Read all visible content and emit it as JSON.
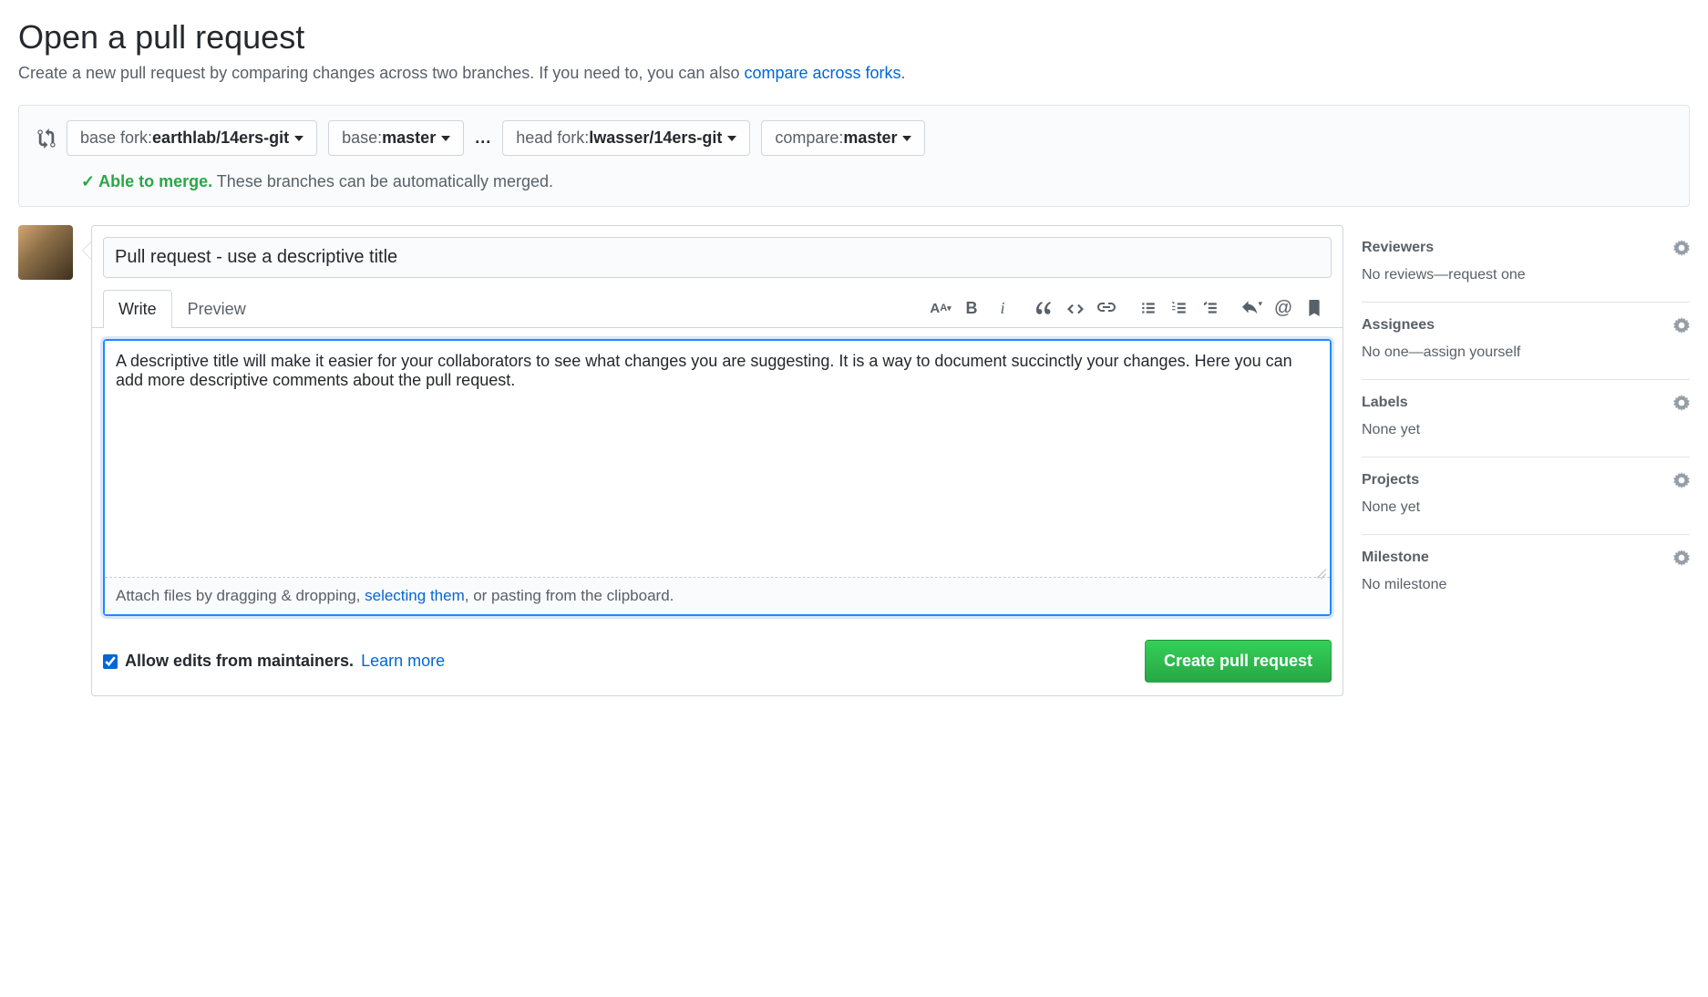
{
  "header": {
    "title": "Open a pull request",
    "subtitle_prefix": "Create a new pull request by comparing changes across two branches. If you need to, you can also ",
    "subtitle_link": "compare across forks",
    "subtitle_suffix": "."
  },
  "compare": {
    "base_fork_label": "base fork: ",
    "base_fork_value": "earthlab/14ers-git",
    "base_label": "base: ",
    "base_value": "master",
    "head_fork_label": "head fork: ",
    "head_fork_value": "lwasser/14ers-git",
    "compare_label": "compare: ",
    "compare_value": "master"
  },
  "merge_status": {
    "check": "✓",
    "ok_text": "Able to merge.",
    "detail": " These branches can be automatically merged."
  },
  "form": {
    "title_value": "Pull request - use a descriptive title",
    "tabs": {
      "write": "Write",
      "preview": "Preview"
    },
    "body_value": "A descriptive title will make it easier for your collaborators to see what changes you are suggesting. It is a way to document succinctly your changes. Here you can add more descriptive comments about the pull request.",
    "attach_prefix": "Attach files by dragging & dropping, ",
    "attach_link": "selecting them",
    "attach_suffix": ", or pasting from the clipboard.",
    "allow_edits_label": "Allow edits from maintainers.",
    "learn_more": "Learn more",
    "create_button": "Create pull request"
  },
  "sidebar": {
    "reviewers": {
      "title": "Reviewers",
      "body": "No reviews—request one"
    },
    "assignees": {
      "title": "Assignees",
      "body_prefix": "No one—",
      "body_link": "assign yourself"
    },
    "labels": {
      "title": "Labels",
      "body": "None yet"
    },
    "projects": {
      "title": "Projects",
      "body": "None yet"
    },
    "milestone": {
      "title": "Milestone",
      "body": "No milestone"
    }
  }
}
